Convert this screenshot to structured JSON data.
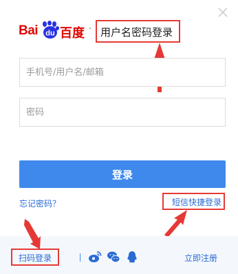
{
  "logo": {
    "text_latin": "Bai",
    "text_du": "du",
    "text_cn": "百度"
  },
  "header": {
    "separator": "·",
    "title": "用户名密码登录"
  },
  "form": {
    "username_placeholder": "手机号/用户名/邮箱",
    "password_placeholder": "密码",
    "submit_label": "登录"
  },
  "links": {
    "forgot_password": "忘记密码？",
    "sms_login": "短信快捷登录",
    "qr_login": "扫码登录",
    "register": "立即注册"
  },
  "social_icons": [
    "weibo-icon",
    "wechat-icon",
    "qq-icon"
  ],
  "colors": {
    "brand_red": "#e10602",
    "baidu_blue": "#2932e1",
    "primary_button": "#3f89ec",
    "link": "#2a6bd3",
    "annotation_red": "#e53935",
    "footer_bg": "#f4f8fd"
  }
}
